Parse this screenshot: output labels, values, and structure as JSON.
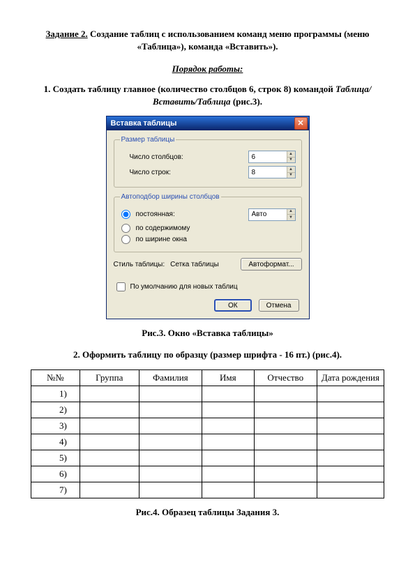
{
  "heading": {
    "task_label": "Задание 2.",
    "rest": " Создание таблиц с использованием команд меню программы (меню «Таблица»), команда «Вставить»)."
  },
  "section_title": "Порядок работы:",
  "step1": {
    "prefix": "1. Создать таблицу главное (количество столбцов 6, строк 8) командой ",
    "cmd": "Таблица/ Вставить/Таблица",
    "suffix": " (рис.3)."
  },
  "dialog": {
    "title": "Вставка таблицы",
    "group_size": "Размер таблицы",
    "cols_label": "Число столбцов:",
    "cols_value": "6",
    "rows_label": "Число строк:",
    "rows_value": "8",
    "group_autofit": "Автоподбор ширины столбцов",
    "radio_fixed": "постоянная:",
    "fixed_value": "Авто",
    "radio_content": "по содержимому",
    "radio_window": "по ширине окна",
    "style_label": "Стиль таблицы:",
    "style_value": "Сетка таблицы",
    "autoformat_btn": "Автоформат...",
    "default_checkbox": "По умолчанию для новых таблиц",
    "ok": "ОК",
    "cancel": "Отмена"
  },
  "caption3": "Рис.3. Окно «Вставка таблицы»",
  "step2": "2. Оформить таблицу по образцу (размер шрифта - 16 пт.) (рис.4).",
  "table": {
    "headers": [
      "№№",
      "Группа",
      "Фамилия",
      "Имя",
      "Отчество",
      "Дата рождения"
    ],
    "rows": [
      "1)",
      "2)",
      "3)",
      "4)",
      "5)",
      "6)",
      "7)"
    ]
  },
  "caption4": "Рис.4. Образец таблицы Задания 3."
}
